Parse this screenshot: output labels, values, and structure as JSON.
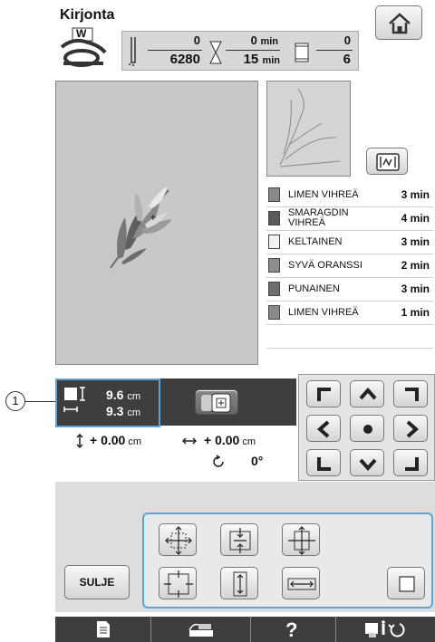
{
  "header": {
    "title": "Kirjonta",
    "presser_foot": "W"
  },
  "counters": {
    "stitch_current": "0",
    "stitch_total": "6280",
    "time_current": "0",
    "time_total": "15",
    "time_unit": "min",
    "color_current": "0",
    "color_total": "6"
  },
  "colors": [
    {
      "name": "LIMEN VIHREÄ",
      "time": "3 min",
      "swatch": "#8a8a8a"
    },
    {
      "name": "SMARAGDIN VIHREÄ",
      "time": "4 min",
      "swatch": "#5a5a5a"
    },
    {
      "name": "KELTAINEN",
      "time": "3 min",
      "swatch": "#f2f2f2"
    },
    {
      "name": "SYVÄ ORANSSI",
      "time": "2 min",
      "swatch": "#8d8d8d"
    },
    {
      "name": "PUNAINEN",
      "time": "3 min",
      "swatch": "#6e6e6e"
    },
    {
      "name": "LIMEN VIHREÄ",
      "time": "1 min",
      "swatch": "#8a8a8a"
    }
  ],
  "size": {
    "height": "9.6",
    "width": "9.3",
    "unit": "cm"
  },
  "offset": {
    "vertical": "+ 0.00",
    "horizontal": "+ 0.00",
    "unit": "cm",
    "angle": "0°"
  },
  "buttons": {
    "close_label": "SULJE"
  },
  "callout": {
    "number": "1"
  }
}
